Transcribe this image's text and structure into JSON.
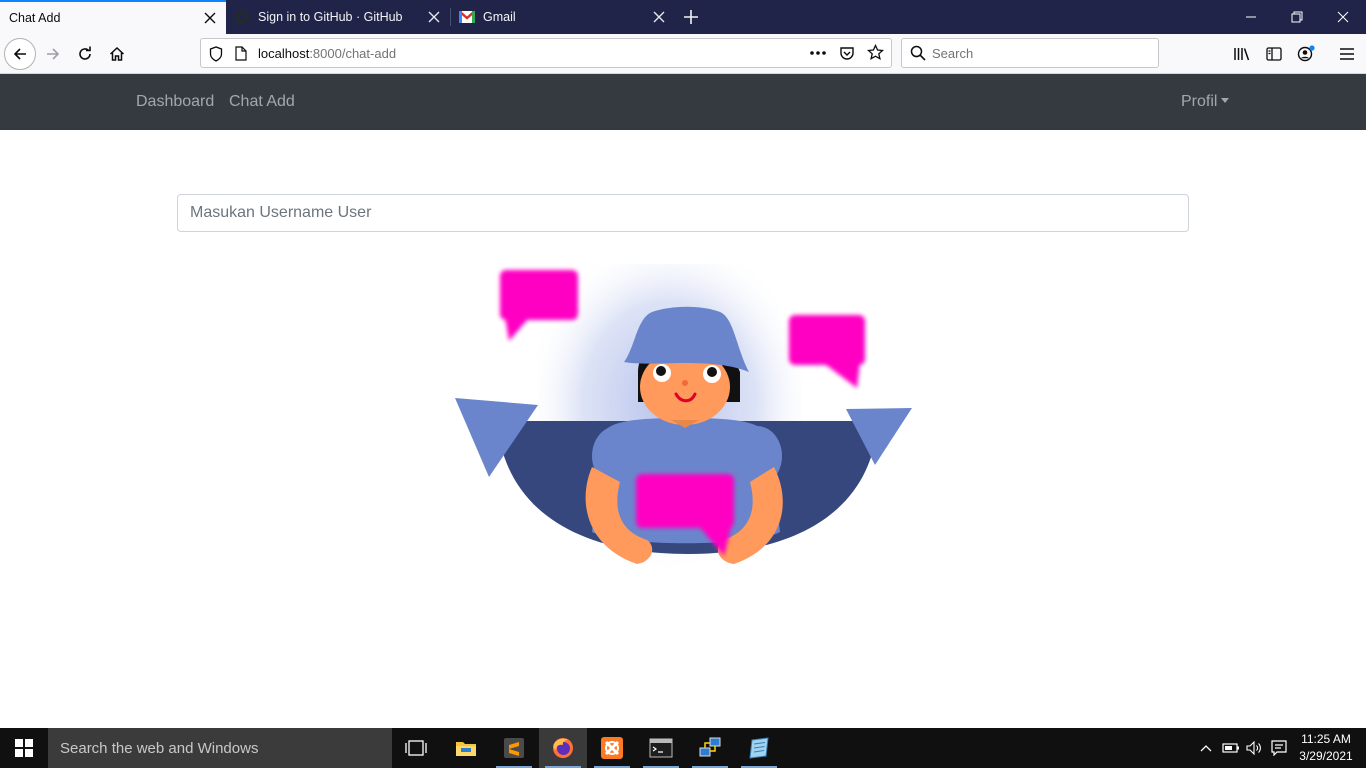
{
  "browser": {
    "tabs": [
      {
        "title": "Chat Add",
        "active": true,
        "icon": "none"
      },
      {
        "title": "Sign in to GitHub · GitHub",
        "active": false,
        "icon": "github-icon"
      },
      {
        "title": "Gmail",
        "active": false,
        "icon": "gmail-icon"
      }
    ],
    "url": {
      "host": "localhost",
      "rest": ":8000/chat-add"
    },
    "search_placeholder": "Search",
    "colors": {
      "tabstrip": "#1f2448",
      "accent": "#0a84ff"
    }
  },
  "navbar": {
    "links": [
      {
        "label": "Dashboard"
      },
      {
        "label": "Chat Add"
      }
    ],
    "profile_label": "Profil",
    "background": "#343a40"
  },
  "main": {
    "username_placeholder": "Masukan Username User",
    "illustration": {
      "description_icon": "chat-person-illustration",
      "colors": {
        "bubble": "#ff00c3",
        "hat": "#6b85cc",
        "skin": "#ff9a5c",
        "bowl": "#35477d"
      }
    }
  },
  "taskbar": {
    "search_placeholder": "Search the web and Windows",
    "apps": [
      {
        "icon": "task-view-icon"
      },
      {
        "icon": "file-explorer-icon"
      },
      {
        "icon": "sublime-text-icon"
      },
      {
        "icon": "firefox-icon"
      },
      {
        "icon": "xampp-icon"
      },
      {
        "icon": "terminal-icon"
      },
      {
        "icon": "network-app-icon"
      },
      {
        "icon": "notepad-icon"
      }
    ],
    "time": "11:25 AM",
    "date": "3/29/2021"
  }
}
